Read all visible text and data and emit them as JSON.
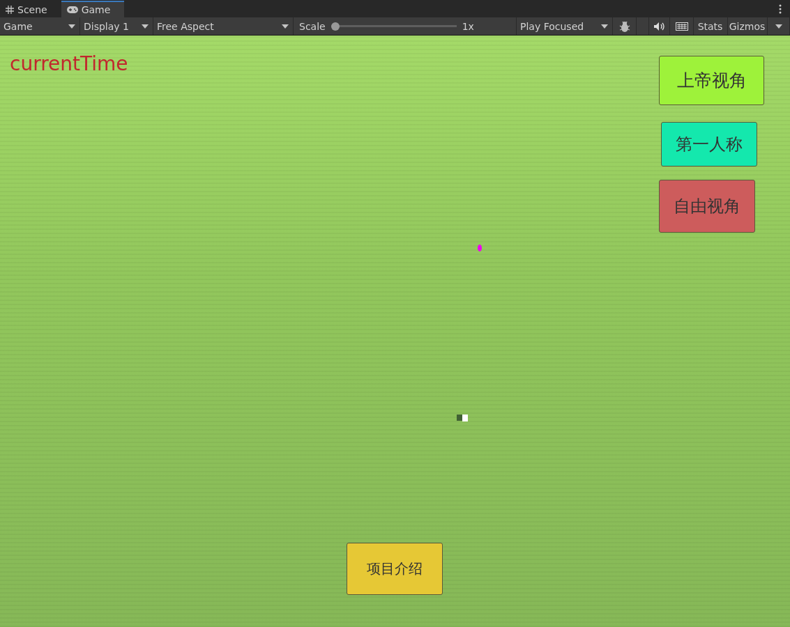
{
  "tabs": [
    {
      "label": "Scene",
      "kind": "scene",
      "selected": false
    },
    {
      "label": "Game",
      "kind": "game",
      "selected": true
    }
  ],
  "toolbar": {
    "dropdowns": [
      {
        "label": "Game"
      },
      {
        "label": "Display 1"
      },
      {
        "label": "Free Aspect"
      }
    ],
    "scale": {
      "label": "Scale",
      "level": 0,
      "reading": "1x"
    },
    "play_mode": {
      "label": "Play Focused"
    },
    "stats": {
      "label": "Stats"
    },
    "gizmos": {
      "label": "Gizmos"
    }
  },
  "game_view": {
    "current_time": "currentTime",
    "buttons": [
      {
        "label": "上帝视角",
        "color": "#9ef23a"
      },
      {
        "label": "第一人称",
        "color": "#14e8ad"
      },
      {
        "label": "自由视角",
        "color": "#cd5c5c"
      },
      {
        "label": "项目介绍",
        "color": "#e6c835"
      }
    ]
  }
}
